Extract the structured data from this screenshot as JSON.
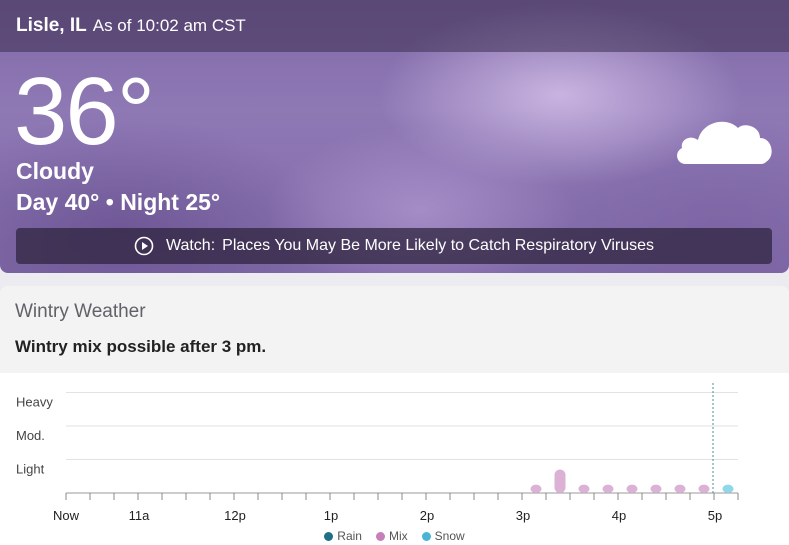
{
  "header": {
    "location": "Lisle, IL",
    "as_of": "As of 10:02 am CST"
  },
  "current": {
    "temperature": "36°",
    "phrase": "Cloudy",
    "day_night": "Day 40° • Night 25°",
    "icon": "cloud-icon"
  },
  "watch": {
    "prefix": "Watch:",
    "title": "Places You May Be More Likely to Catch Respiratory Viruses",
    "icon": "play-circle-icon"
  },
  "wintry": {
    "title": "Wintry Weather",
    "description": "Wintry mix possible after 3 pm."
  },
  "colors": {
    "rain": "#1f6f86",
    "mix": "#d7a6cf",
    "snow": "#5fc6e0",
    "hero": "#8a74b0"
  },
  "chart_data": {
    "type": "bar",
    "y_categories": [
      "Light",
      "Mod.",
      "Heavy"
    ],
    "x_tick_labels": [
      "Now",
      "11a",
      "12p",
      "1p",
      "2p",
      "3p",
      "4p",
      "5p"
    ],
    "now_marker_label": "5p",
    "legend": [
      {
        "name": "Rain",
        "color": "#1f6f86"
      },
      {
        "name": "Mix",
        "color": "#d7a6cf"
      },
      {
        "name": "Snow",
        "color": "#5fc6e0"
      }
    ],
    "series": [
      {
        "name": "Mix",
        "points": [
          {
            "t": "3:10p",
            "intensity": 0.25
          },
          {
            "t": "3:25p",
            "intensity": 0.7
          },
          {
            "t": "3:40p",
            "intensity": 0.25
          },
          {
            "t": "3:55p",
            "intensity": 0.25
          },
          {
            "t": "4:10p",
            "intensity": 0.25
          },
          {
            "t": "4:25p",
            "intensity": 0.25
          },
          {
            "t": "4:40p",
            "intensity": 0.25
          },
          {
            "t": "4:55p",
            "intensity": 0.25
          }
        ]
      },
      {
        "name": "Snow",
        "points": [
          {
            "t": "5:10p",
            "intensity": 0.25
          }
        ]
      }
    ]
  }
}
